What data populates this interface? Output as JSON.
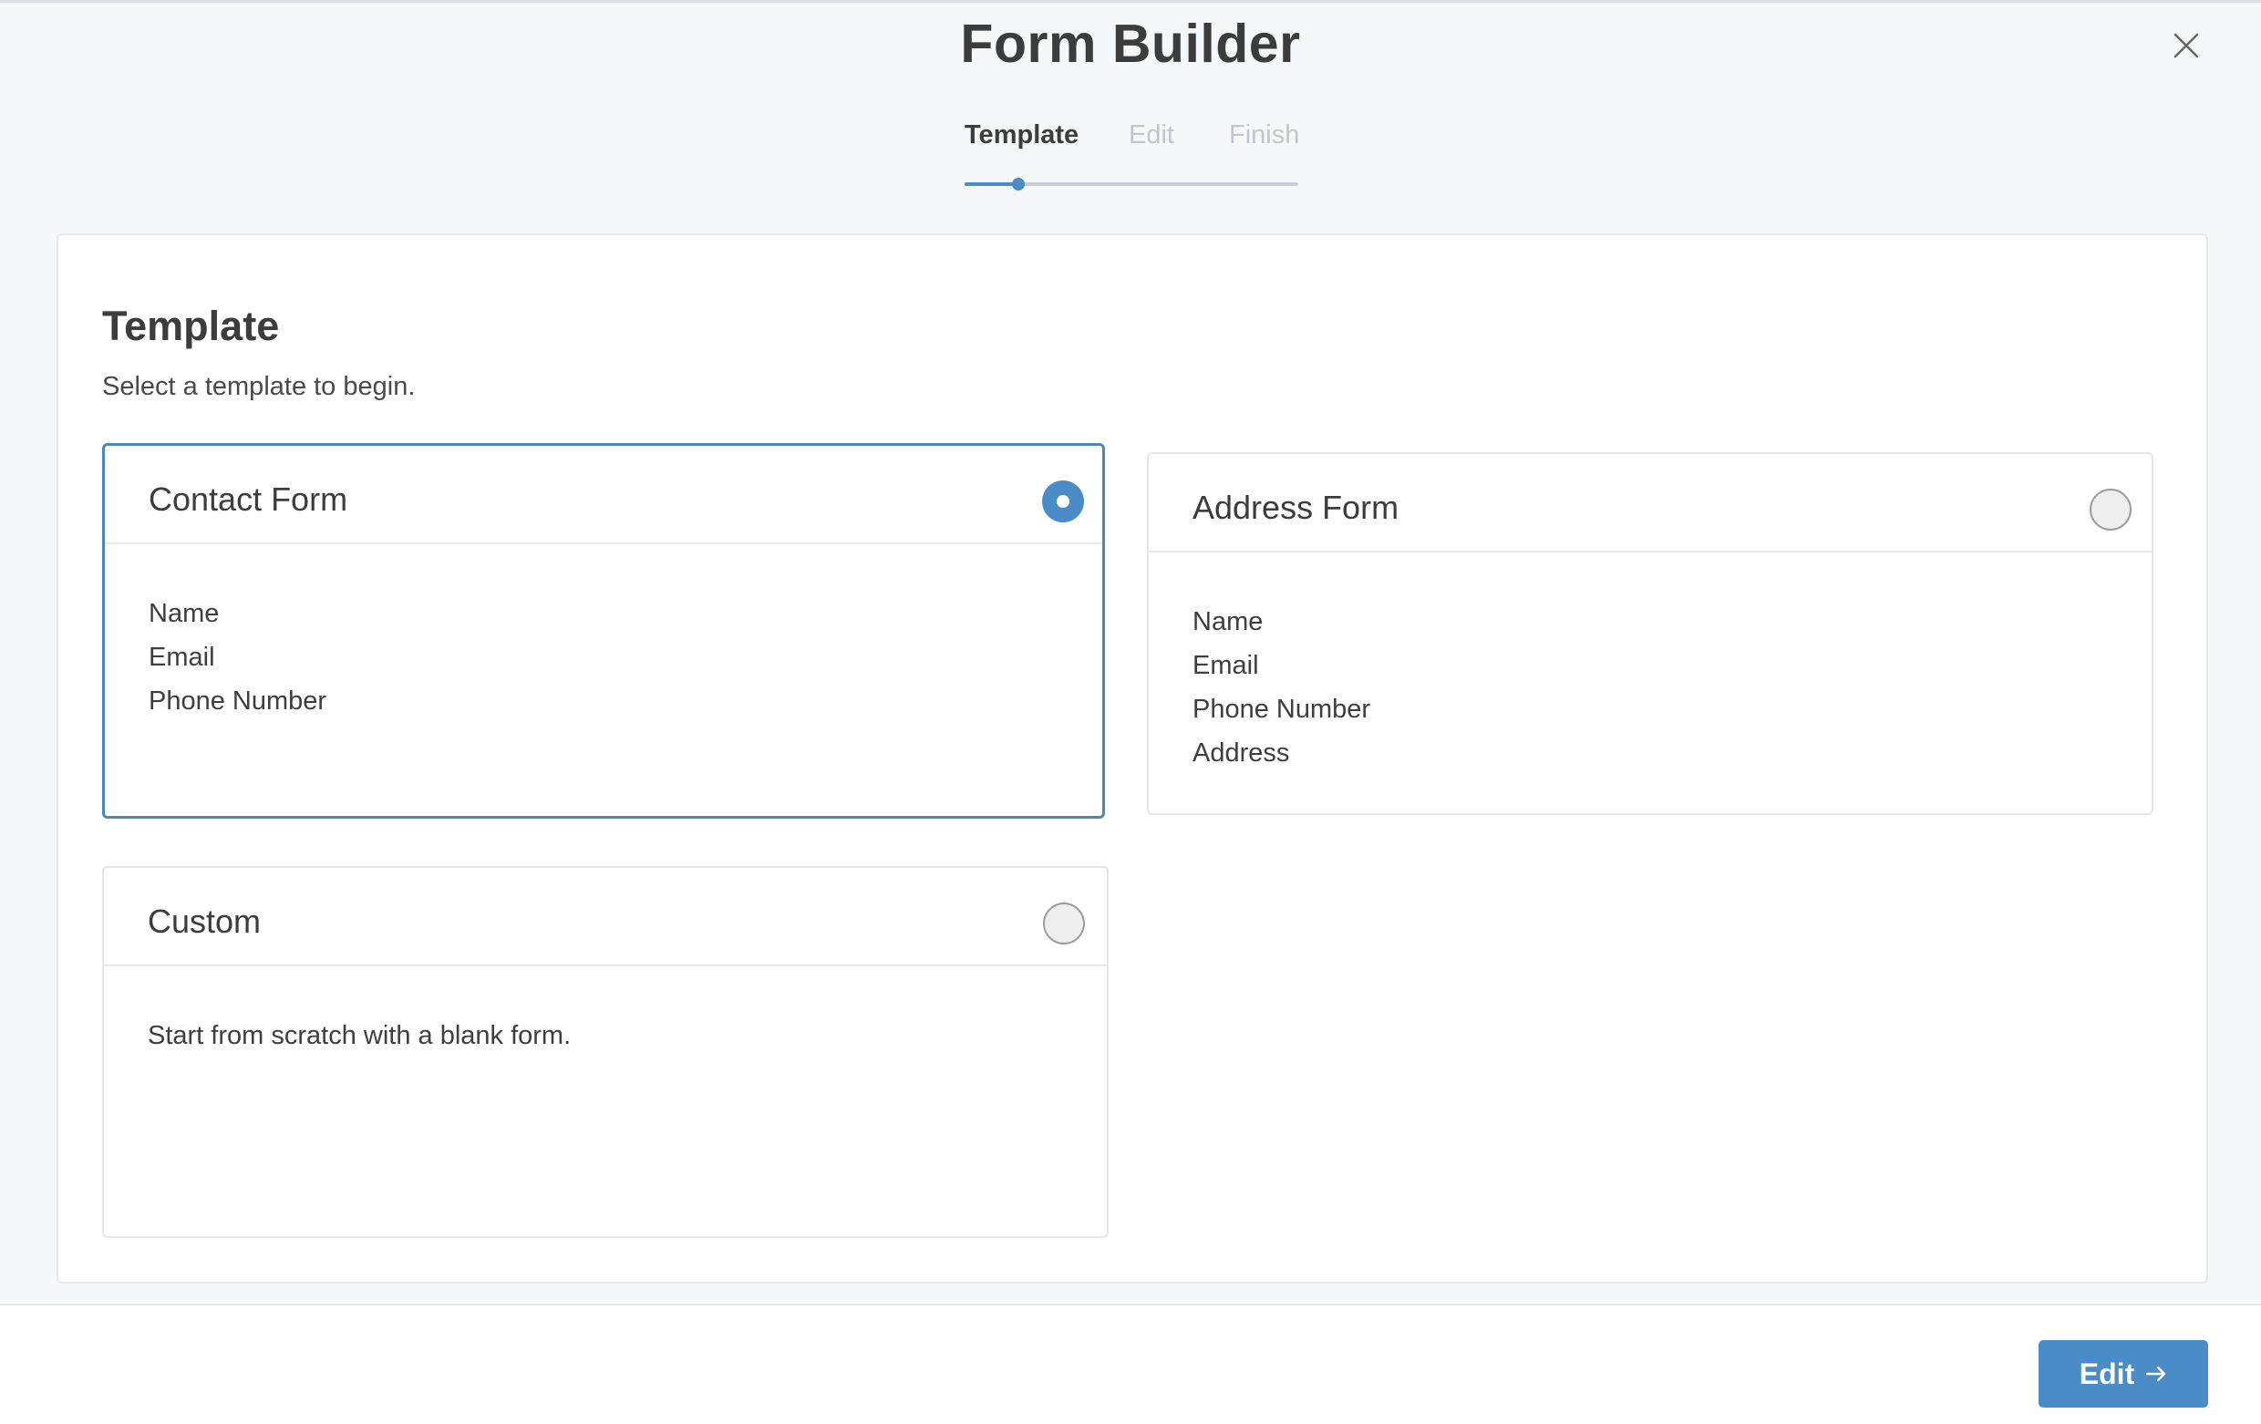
{
  "header": {
    "title": "Form Builder",
    "close_icon": "close-icon"
  },
  "stepper": {
    "steps": [
      {
        "label": "Template",
        "state": "active"
      },
      {
        "label": "Edit",
        "state": "pending"
      },
      {
        "label": "Finish",
        "state": "pending"
      }
    ],
    "progress_fraction": 0.16
  },
  "panel": {
    "title": "Template",
    "subtitle": "Select a template to begin."
  },
  "templates": [
    {
      "title": "Contact Form",
      "selected": true,
      "lines": [
        "Name",
        "Email",
        "Phone Number"
      ]
    },
    {
      "title": "Address Form",
      "selected": false,
      "lines": [
        "Name",
        "Email",
        "Phone Number",
        "Address"
      ]
    },
    {
      "title": "Custom",
      "selected": false,
      "lines": [
        "Start from scratch with a blank form."
      ]
    }
  ],
  "footer": {
    "next_label": "Edit",
    "next_icon": "arrow-right-icon"
  },
  "colors": {
    "accent": "#4a8cc7",
    "selected_border": "#4a87bd",
    "inactive_step": "#c2c6cc",
    "background": "#f6f7f9"
  }
}
